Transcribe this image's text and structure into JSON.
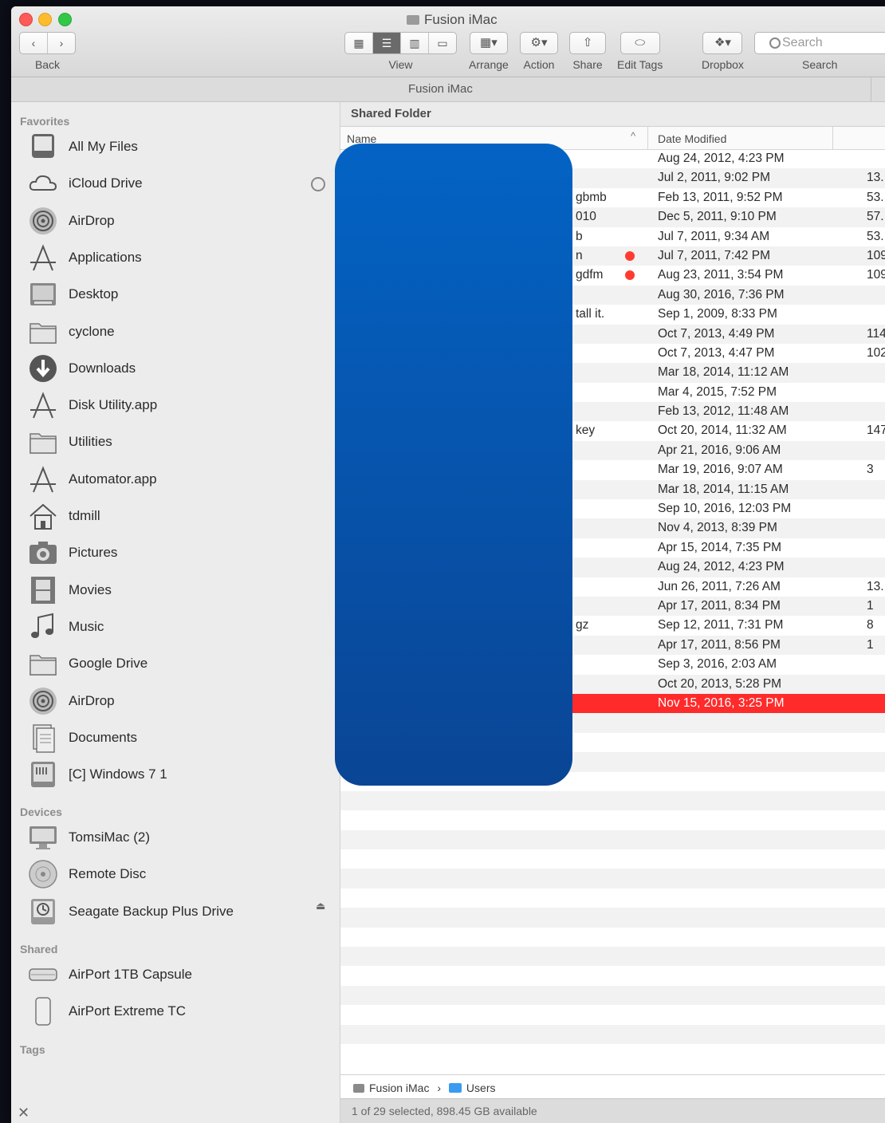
{
  "window": {
    "title": "Fusion iMac",
    "path_title": "Fusion iMac"
  },
  "toolbar": {
    "back_label": "Back",
    "view_label": "View",
    "arrange_label": "Arrange",
    "action_label": "Action",
    "share_label": "Share",
    "edit_tags_label": "Edit Tags",
    "dropbox_label": "Dropbox",
    "search_label": "Search",
    "search_placeholder": "Search"
  },
  "sidebar": {
    "favorites_heading": "Favorites",
    "favorites": [
      {
        "label": "All My Files",
        "icon": "all-files-icon"
      },
      {
        "label": "iCloud Drive",
        "icon": "cloud-icon"
      },
      {
        "label": "AirDrop",
        "icon": "airdrop-icon"
      },
      {
        "label": "Applications",
        "icon": "applications-icon"
      },
      {
        "label": "Desktop",
        "icon": "desktop-icon"
      },
      {
        "label": "cyclone",
        "icon": "folder-icon"
      },
      {
        "label": "Downloads",
        "icon": "downloads-icon"
      },
      {
        "label": "Disk Utility.app",
        "icon": "app-icon"
      },
      {
        "label": "Utilities",
        "icon": "folder-icon"
      },
      {
        "label": "Automator.app",
        "icon": "app-icon"
      },
      {
        "label": "tdmill",
        "icon": "home-icon"
      },
      {
        "label": "Pictures",
        "icon": "camera-icon"
      },
      {
        "label": "Movies",
        "icon": "film-icon"
      },
      {
        "label": "Music",
        "icon": "music-icon"
      },
      {
        "label": "Google Drive",
        "icon": "folder-icon"
      },
      {
        "label": "AirDrop",
        "icon": "airdrop-icon"
      },
      {
        "label": "Documents",
        "icon": "documents-icon"
      },
      {
        "label": "[C] Windows 7 1",
        "icon": "drive-icon"
      }
    ],
    "devices_heading": "Devices",
    "devices": [
      {
        "label": "TomsiMac (2)",
        "icon": "imac-icon"
      },
      {
        "label": "Remote Disc",
        "icon": "disc-icon"
      },
      {
        "label": "Seagate Backup Plus Drive",
        "icon": "timemachine-drive-icon"
      }
    ],
    "shared_heading": "Shared",
    "shared": [
      {
        "label": "AirPort 1TB Capsule",
        "icon": "airport-capsule-icon"
      },
      {
        "label": "AirPort Extreme TC",
        "icon": "airport-extreme-icon"
      }
    ],
    "tags_heading": "Tags"
  },
  "content": {
    "header": "Shared Folder",
    "col_name": "Name",
    "col_date": "Date Modified",
    "sort_arrow": "^",
    "rows": [
      {
        "frag": "",
        "tag": false,
        "date": "Aug 24, 2012, 4:23 PM",
        "size": ""
      },
      {
        "frag": "",
        "tag": false,
        "date": "Jul 2, 2011, 9:02 PM",
        "size": "13."
      },
      {
        "frag": "gbmb",
        "tag": false,
        "date": "Feb 13, 2011, 9:52 PM",
        "size": "53."
      },
      {
        "frag": "010",
        "tag": false,
        "date": "Dec 5, 2011, 9:10 PM",
        "size": "57."
      },
      {
        "frag": "b",
        "tag": false,
        "date": "Jul 7, 2011, 9:34 AM",
        "size": "53."
      },
      {
        "frag": "n",
        "tag": true,
        "date": "Jul 7, 2011, 7:42 PM",
        "size": "109."
      },
      {
        "frag": "gdfm",
        "tag": true,
        "date": "Aug 23, 2011, 3:54 PM",
        "size": "109."
      },
      {
        "frag": "",
        "tag": false,
        "date": "Aug 30, 2016, 7:36 PM",
        "size": ""
      },
      {
        "frag": "tall it.",
        "tag": false,
        "date": "Sep 1, 2009, 8:33 PM",
        "size": ""
      },
      {
        "frag": "",
        "tag": false,
        "date": "Oct 7, 2013, 4:49 PM",
        "size": "114."
      },
      {
        "frag": "",
        "tag": false,
        "date": "Oct 7, 2013, 4:47 PM",
        "size": "102."
      },
      {
        "frag": "",
        "tag": false,
        "date": "Mar 18, 2014, 11:12 AM",
        "size": ""
      },
      {
        "frag": "",
        "tag": false,
        "date": "Mar 4, 2015, 7:52 PM",
        "size": ""
      },
      {
        "frag": "",
        "tag": false,
        "date": "Feb 13, 2012, 11:48 AM",
        "size": ""
      },
      {
        "frag": "key",
        "tag": false,
        "date": "Oct 20, 2014, 11:32 AM",
        "size": "147."
      },
      {
        "frag": "",
        "tag": false,
        "date": "Apr 21, 2016, 9:06 AM",
        "size": ""
      },
      {
        "frag": "",
        "tag": false,
        "date": "Mar 19, 2016, 9:07 AM",
        "size": "3"
      },
      {
        "frag": "",
        "tag": false,
        "date": "Mar 18, 2014, 11:15 AM",
        "size": ""
      },
      {
        "frag": "",
        "tag": false,
        "date": "Sep 10, 2016, 12:03 PM",
        "size": ""
      },
      {
        "frag": "",
        "tag": false,
        "date": "Nov 4, 2013, 8:39 PM",
        "size": ""
      },
      {
        "frag": "",
        "tag": false,
        "date": "Apr 15, 2014, 7:35 PM",
        "size": ""
      },
      {
        "frag": "",
        "tag": false,
        "date": "Aug 24, 2012, 4:23 PM",
        "size": ""
      },
      {
        "frag": "",
        "tag": false,
        "date": "Jun 26, 2011, 7:26 AM",
        "size": "13."
      },
      {
        "frag": "",
        "tag": false,
        "date": "Apr 17, 2011, 8:34 PM",
        "size": "1"
      },
      {
        "frag": "gz",
        "tag": false,
        "date": "Sep 12, 2011, 7:31 PM",
        "size": "8"
      },
      {
        "frag": "",
        "tag": false,
        "date": "Apr 17, 2011, 8:56 PM",
        "size": "1"
      },
      {
        "frag": "",
        "tag": false,
        "date": "Sep 3, 2016, 2:03 AM",
        "size": ""
      },
      {
        "frag": "",
        "tag": false,
        "date": "Oct 20, 2013, 5:28 PM",
        "size": ""
      },
      {
        "frag": "",
        "tag": false,
        "date": "Nov 15, 2016, 3:25 PM",
        "size": "",
        "selected": true
      }
    ]
  },
  "pathbar": {
    "root": "Fusion iMac",
    "separator": "›",
    "folder": "Users"
  },
  "status": {
    "text": "1 of 29 selected, 898.45 GB available"
  },
  "colors": {
    "selection": "#ff2b2b",
    "tag_red": "#ff3b30",
    "redaction_blue": "#0a55b0"
  }
}
